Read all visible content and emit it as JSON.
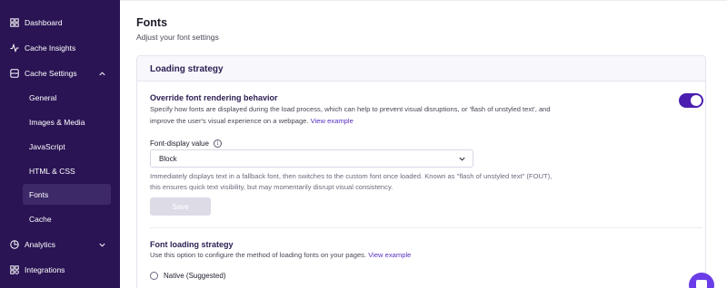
{
  "sidebar": {
    "items": [
      {
        "label": "Dashboard",
        "icon": "dashboard-icon"
      },
      {
        "label": "Cache Insights",
        "icon": "activity-icon"
      },
      {
        "label": "Cache Settings",
        "icon": "layers-icon",
        "expanded": true
      },
      {
        "label": "Analytics",
        "icon": "pie-chart-icon",
        "expanded": false
      },
      {
        "label": "Integrations",
        "icon": "grid-icon"
      }
    ],
    "sub_items": [
      {
        "label": "General"
      },
      {
        "label": "Images & Media"
      },
      {
        "label": "JavaScript"
      },
      {
        "label": "HTML & CSS"
      },
      {
        "label": "Fonts",
        "active": true
      },
      {
        "label": "Cache"
      }
    ]
  },
  "page": {
    "title": "Fonts",
    "subtitle": "Adjust your font settings"
  },
  "panel": {
    "title": "Loading strategy",
    "override": {
      "title": "Override font rendering behavior",
      "description_line1": "Specify how fonts are displayed during the load process, which can help to prevent visual disruptions, or 'flash of unstyled text', and",
      "description_line2": "improve the user's visual experience on a webpage.",
      "link": "View example",
      "enabled": true
    },
    "font_display": {
      "label": "Font-display value",
      "selected": "Block",
      "hint_line1": "Immediately displays text in a fallback font, then switches to the custom font once loaded. Known as \"flash of unstyled text\" (FOUT),",
      "hint_line2": "this ensures quick text visibility, but may momentarily disrupt visual consistency."
    },
    "save_label": "Save",
    "font_loading": {
      "title": "Font loading strategy",
      "description": "Use this option to configure the method of loading fonts on your pages.",
      "link": "View example",
      "option_native": "Native (Suggested)"
    }
  },
  "colors": {
    "sidebar_bg": "#2a1454",
    "accent": "#4b1fb0",
    "link": "#5a2fc2"
  }
}
